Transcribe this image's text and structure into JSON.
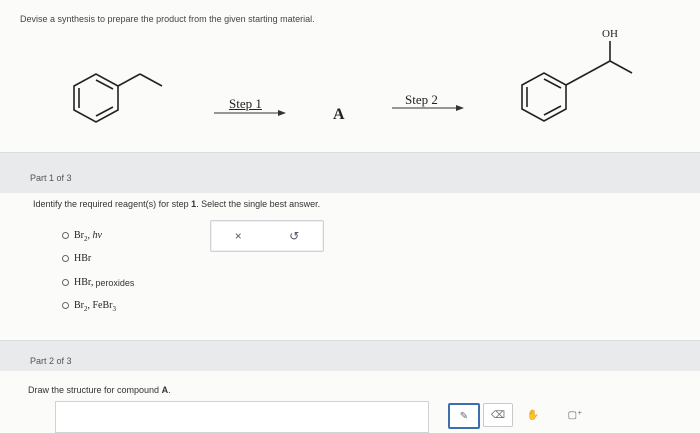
{
  "prompt": "Devise a synthesis to prepare the product from the given starting material.",
  "scheme": {
    "step1_label": "Step 1",
    "step2_label": "Step 2",
    "intermediate": "A",
    "product_group_label": "OH"
  },
  "part1": {
    "header": "Part 1 of 3",
    "question_prefix": "Identify the required reagent(s) for step ",
    "question_step": "1",
    "question_suffix": ". Select the single best answer.",
    "options": [
      {
        "reagent": "Br",
        "sub": "2",
        "tail": ", hv",
        "plain": ""
      },
      {
        "reagent": "HBr",
        "sub": "",
        "tail": "",
        "plain": ""
      },
      {
        "reagent": "HBr",
        "sub": "",
        "tail": ",",
        "plain": "peroxides"
      },
      {
        "reagent": "Br",
        "sub": "2",
        "tail": ", FeBr",
        "tail_sub": "3",
        "plain": ""
      }
    ],
    "controls": {
      "clear": "×",
      "undo": "↺"
    }
  },
  "part2": {
    "header": "Part 2 of 3",
    "question_prefix": "Draw the structure for compound ",
    "question_compound": "A",
    "question_suffix": "."
  },
  "toolbar": {
    "tools": [
      {
        "icon": "pencil-icon",
        "glyph": "✎"
      },
      {
        "icon": "eraser-icon",
        "glyph": "⌫"
      },
      {
        "icon": "hand-icon",
        "glyph": "✋"
      },
      {
        "icon": "add-ring-icon",
        "glyph": "▢⁺"
      }
    ]
  }
}
